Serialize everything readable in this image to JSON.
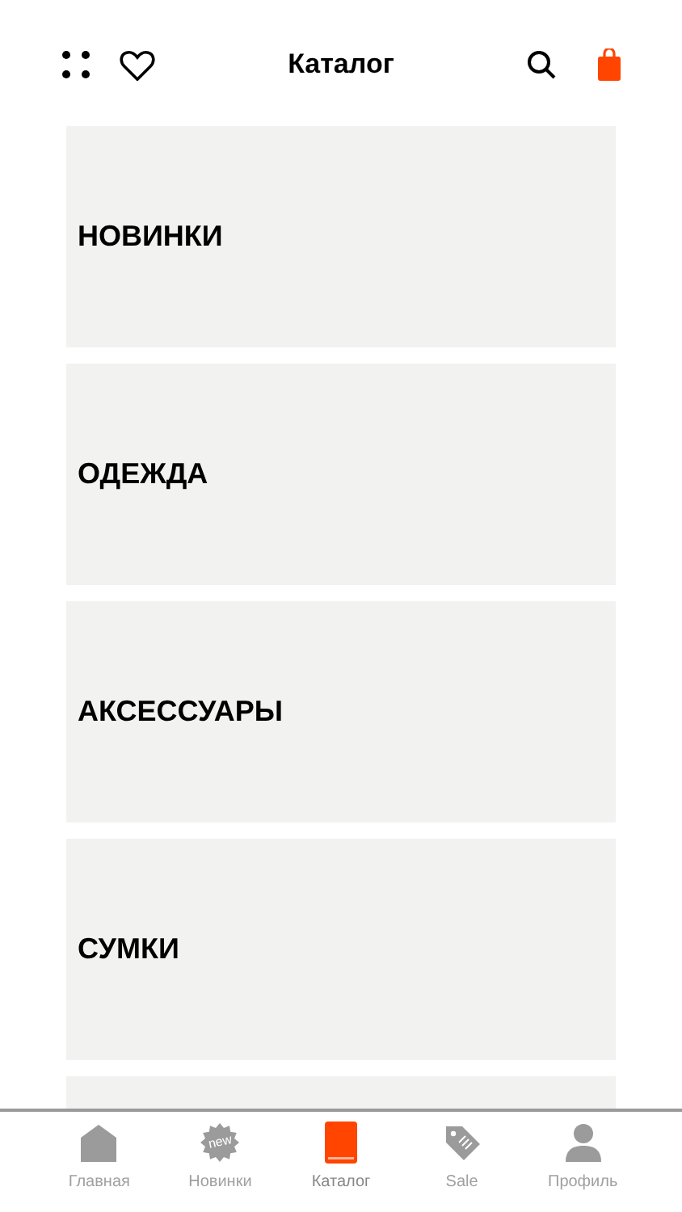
{
  "header": {
    "title": "Каталог"
  },
  "categories": [
    {
      "label": "НОВИНКИ"
    },
    {
      "label": "ОДЕЖДА"
    },
    {
      "label": "АКСЕССУАРЫ"
    },
    {
      "label": "СУМКИ"
    }
  ],
  "tab_bar": [
    {
      "kind": "home",
      "label": "Главная",
      "selected": false
    },
    {
      "kind": "new",
      "label": "Новинки",
      "badge": "new",
      "selected": false
    },
    {
      "kind": "catalog",
      "label": "Каталог",
      "selected": true
    },
    {
      "kind": "sale",
      "label": "Sale",
      "selected": false
    },
    {
      "kind": "profile",
      "label": "Профиль",
      "selected": false
    }
  ]
}
